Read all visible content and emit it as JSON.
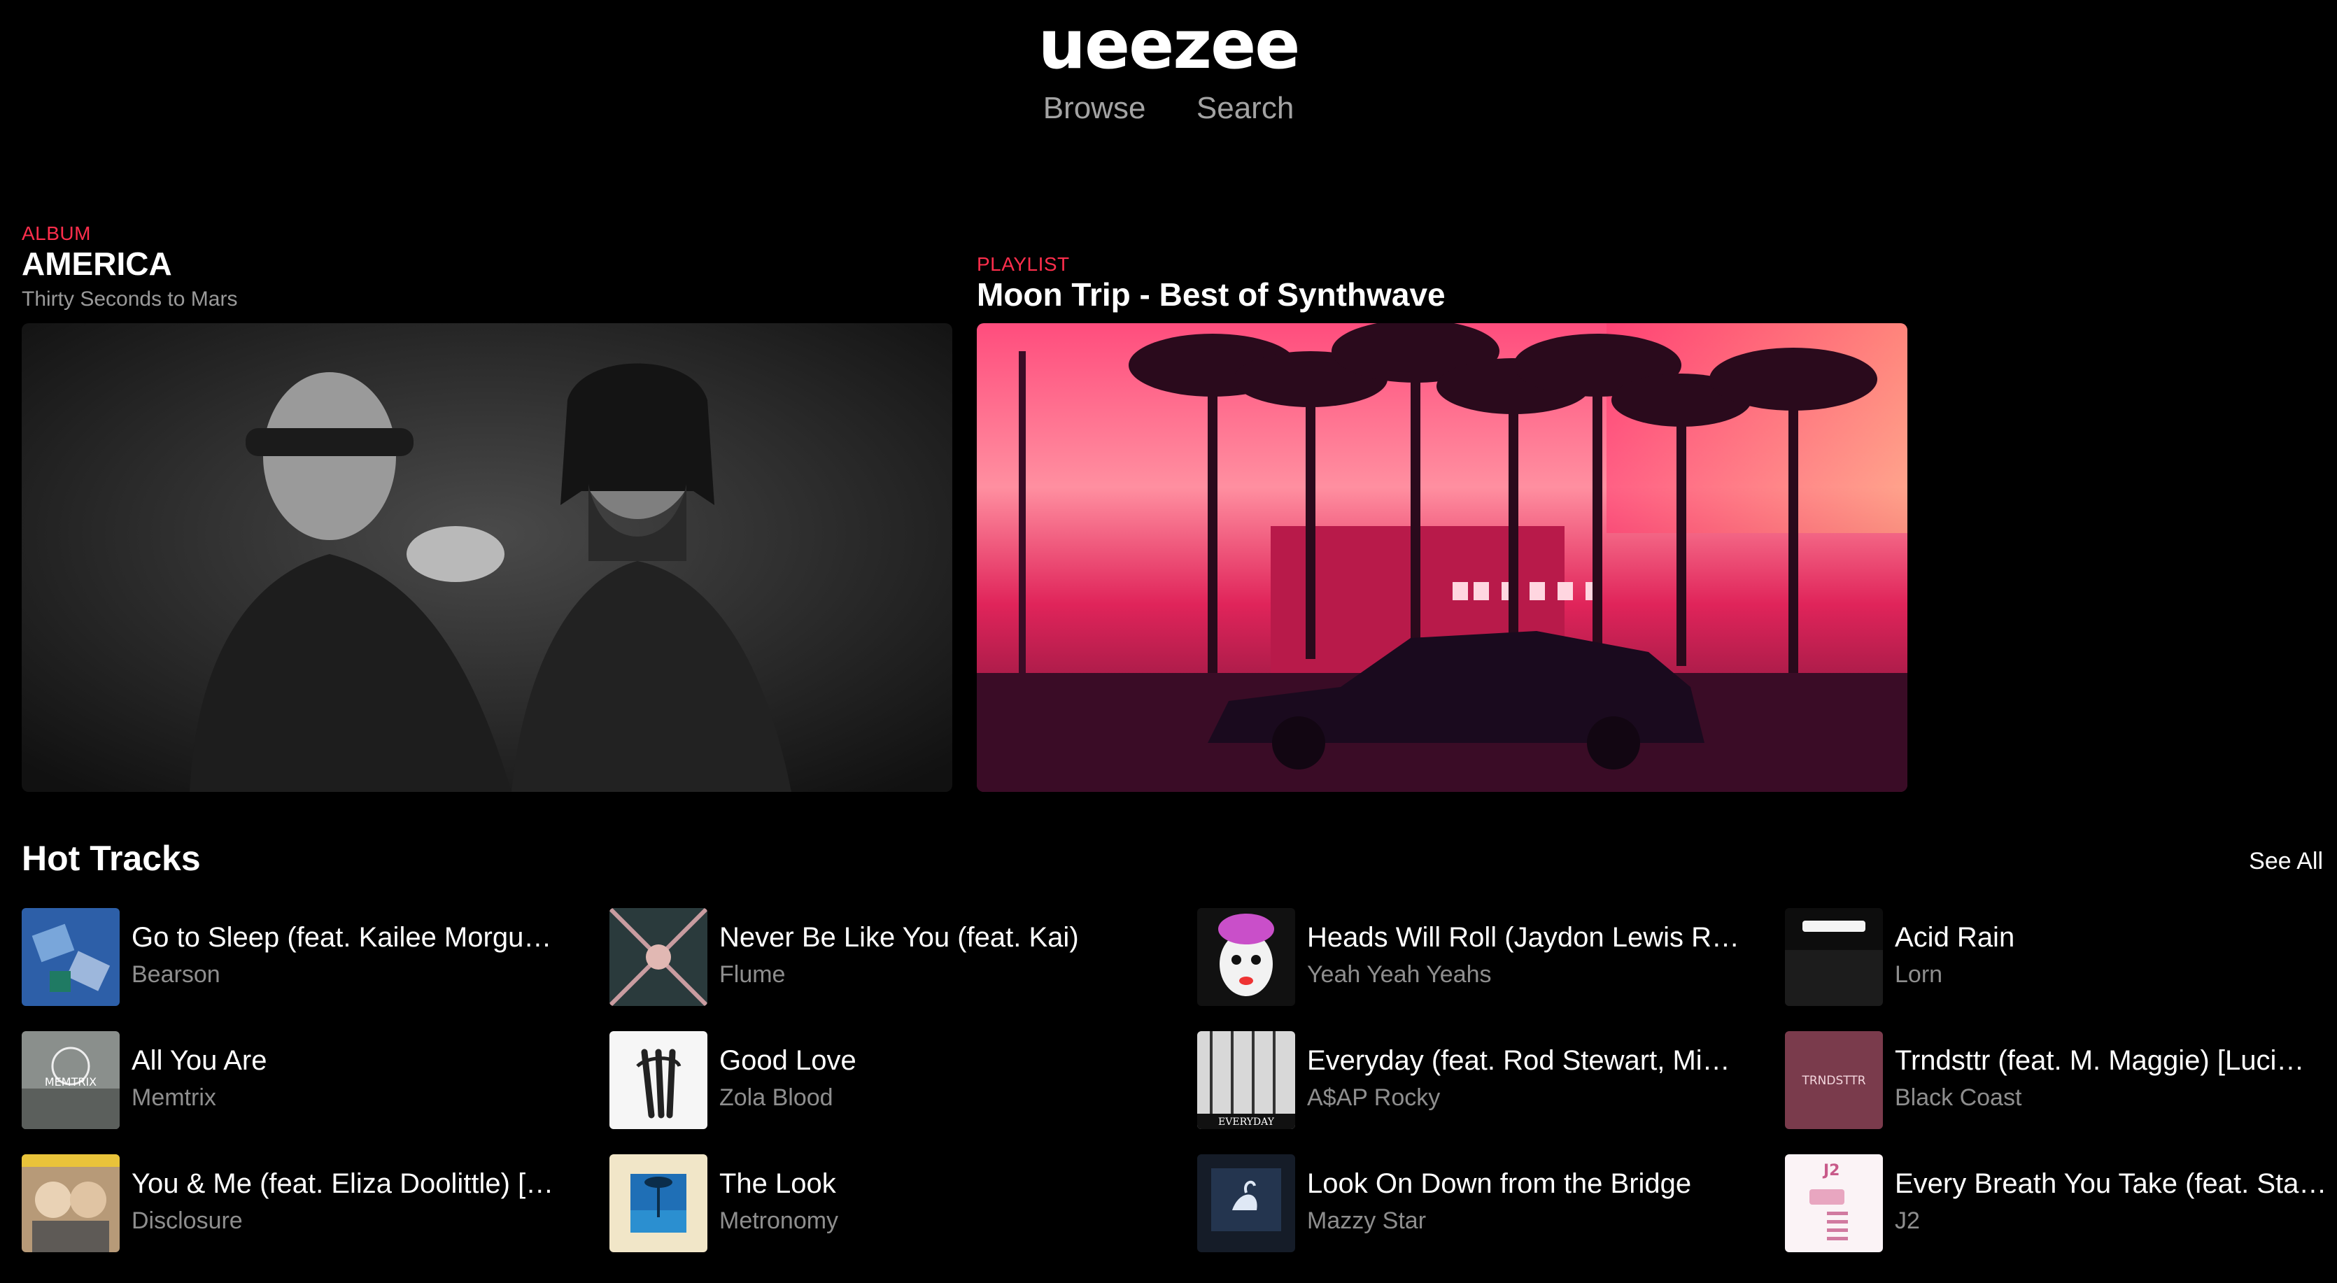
{
  "header": {
    "logo": "ueezee",
    "nav": [
      "Browse",
      "Search"
    ]
  },
  "featured": [
    {
      "kind": "ALBUM",
      "title": "AMERICA",
      "subtitle": "Thirty Seconds to Mars"
    },
    {
      "kind": "PLAYLIST",
      "title": "Moon Trip - Best of Synthwave",
      "subtitle": ""
    }
  ],
  "hot_tracks": {
    "title": "Hot Tracks",
    "see_all": "See All",
    "items": [
      {
        "title": "Go to Sleep (feat. Kailee Morgu…",
        "artist": "Bearson"
      },
      {
        "title": "Never Be Like You (feat. Kai)",
        "artist": "Flume"
      },
      {
        "title": "Heads Will Roll (Jaydon Lewis R…",
        "artist": "Yeah Yeah Yeahs"
      },
      {
        "title": "Acid Rain",
        "artist": "Lorn"
      },
      {
        "title": "All You Are",
        "artist": "Memtrix"
      },
      {
        "title": "Good Love",
        "artist": "Zola Blood"
      },
      {
        "title": "Everyday (feat. Rod Stewart, Mi…",
        "artist": "A$AP Rocky"
      },
      {
        "title": "Trndsttr (feat. M. Maggie) [Luci…",
        "artist": "Black Coast"
      },
      {
        "title": "You & Me (feat. Eliza Doolittle) […",
        "artist": "Disclosure"
      },
      {
        "title": "The Look",
        "artist": "Metronomy"
      },
      {
        "title": "Look On Down from the Bridge",
        "artist": "Mazzy Star"
      },
      {
        "title": "Every Breath You Take (feat. Sta…",
        "artist": "J2"
      }
    ]
  },
  "cover_art_text": {
    "memtrix": "MEMTRIX",
    "everyday": "EVERYDAY",
    "trndsttr": "TRNDSTTR",
    "j2": "J2"
  },
  "colors": {
    "accent": "#ff2e4c",
    "background": "#000000",
    "muted_text": "#8e8e8e"
  }
}
